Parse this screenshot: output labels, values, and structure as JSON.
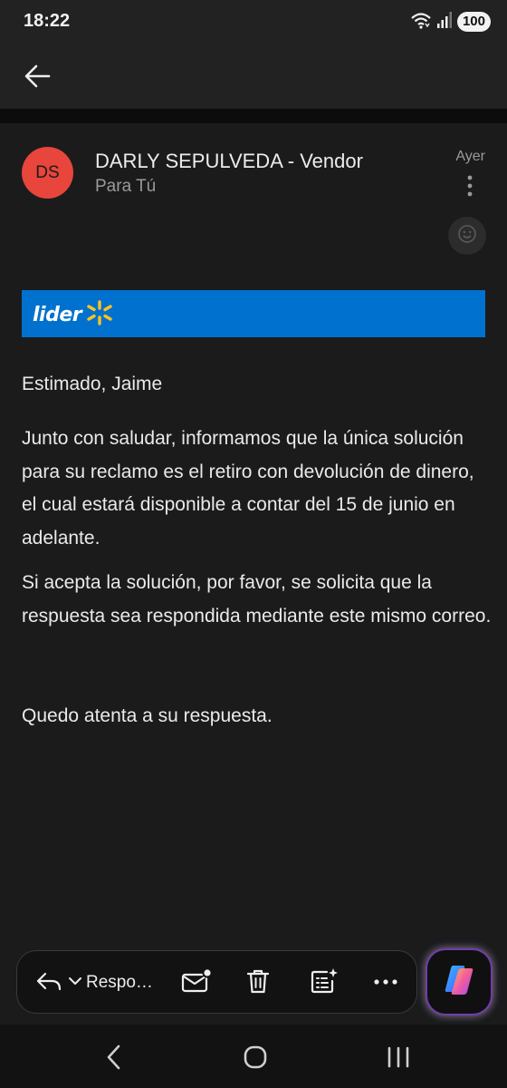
{
  "status_bar": {
    "time": "18:22",
    "battery": "100",
    "icons": [
      "wifi-icon",
      "signal-icon",
      "battery-icon"
    ]
  },
  "app_bar": {
    "back_icon": "back-arrow-icon"
  },
  "email": {
    "avatar_initials": "DS",
    "avatar_color": "#e8453c",
    "sender": "DARLY SEPULVEDA - Vendor",
    "recipient": "Para Tú",
    "date": "Ayer",
    "more_icon": "more-vertical-icon",
    "reaction_icon": "smiley-icon",
    "banner": {
      "brand_text": "lider",
      "brand_color": "#0071ce",
      "spark_color": "#ffc220"
    },
    "greeting": "Estimado, Jaime",
    "paragraph_1": "Junto con saludar, informamos que la única solución para su reclamo es el retiro con devolución de dinero, el cual estará disponible a contar del 15 de junio en adelante.",
    "paragraph_2": "Si acepta la solución, por favor, se solicita que la respuesta sea respondida mediante este mismo correo.",
    "closing": "Quedo atenta a su respuesta."
  },
  "toolbar": {
    "reply_label": "Respo…",
    "items": [
      "reply-icon",
      "chevron-down-icon",
      "mark-unread-icon",
      "trash-icon",
      "summarize-icon",
      "more-horizontal-icon"
    ]
  },
  "copilot": {
    "icon": "copilot-icon"
  },
  "nav_bar": {
    "items": [
      "nav-back-icon",
      "nav-home-icon",
      "nav-recents-icon"
    ]
  }
}
